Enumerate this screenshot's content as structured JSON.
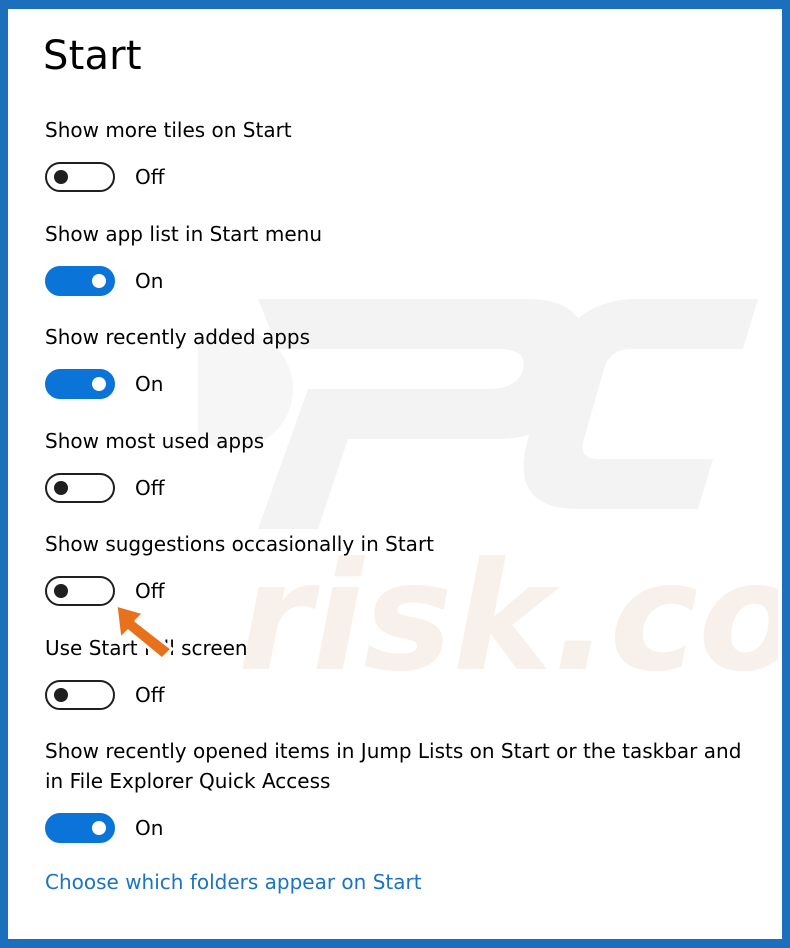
{
  "page": {
    "title": "Start"
  },
  "settings": [
    {
      "label": "Show more tiles on Start",
      "state": "Off"
    },
    {
      "label": "Show app list in Start menu",
      "state": "On"
    },
    {
      "label": "Show recently added apps",
      "state": "On"
    },
    {
      "label": "Show most used apps",
      "state": "Off"
    },
    {
      "label": "Show suggestions occasionally in Start",
      "state": "Off"
    },
    {
      "label": "Use Start full screen",
      "state": "Off"
    },
    {
      "label": "Show recently opened items in Jump Lists on Start or the taskbar and in File Explorer Quick Access",
      "state": "On"
    }
  ],
  "link": {
    "label": "Choose which folders appear on Start"
  },
  "colors": {
    "accent": "#0a74d9",
    "link": "#1a73c4",
    "border": "#1b6fbd",
    "arrow": "#e8721c"
  },
  "annotation": {
    "icon": "pointer-arrow-icon",
    "target": "Show suggestions occasionally in Start"
  },
  "watermark": {
    "icon": "pcrisk-logo-watermark"
  }
}
